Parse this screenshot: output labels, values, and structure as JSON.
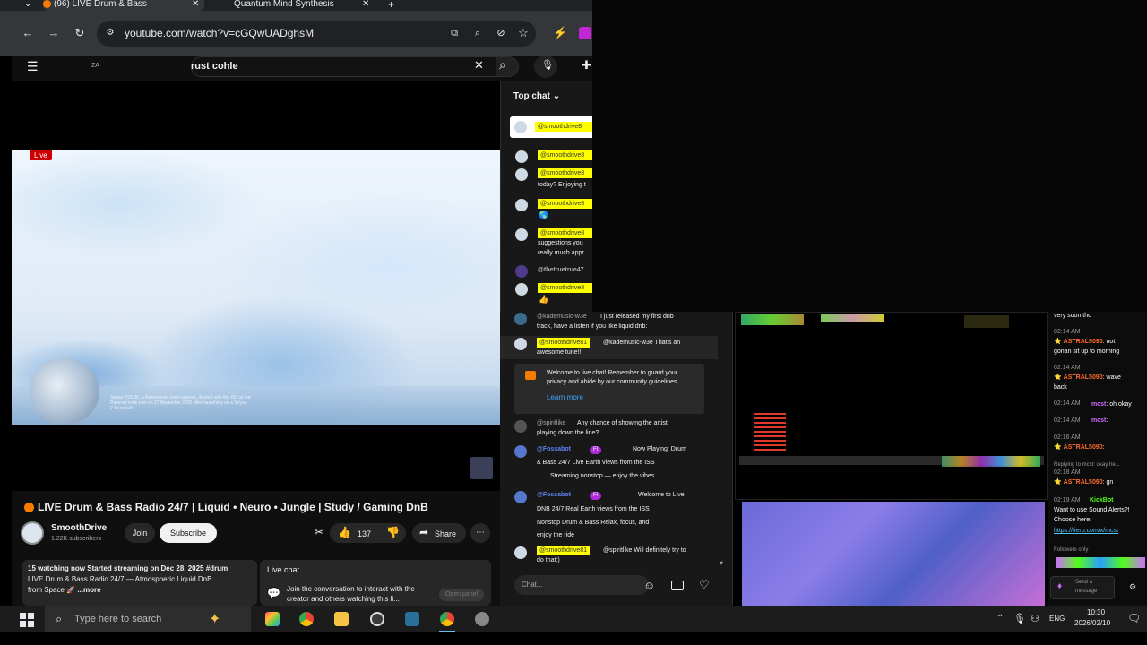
{
  "browser": {
    "tab1_title": "(96) LIVE Drum & Bass",
    "tab2_title": "Quantum Mind Synthesis",
    "url": "youtube.com/watch?v=cGQwUADghsM"
  },
  "youtube": {
    "country_code": "ZA",
    "search_value": "rust cohle",
    "live_badge": "Live",
    "video_caption": "Space: ISS 05, a Roscosmos crew capsule, docked with the ISS at the Rassvet node port on 27 November 2025 after launching on a Soyuz-2.1a rocket",
    "video_title": "LIVE Drum & Bass Radio 24/7 | Liquid • Neuro • Jungle | Study / Gaming DnB",
    "channel_name": "SmoothDrive",
    "subscribers": "1.22K subscribers",
    "join_label": "Join",
    "subscribe_label": "Subscribe",
    "like_count": "137",
    "share_label": "Share",
    "description_line1": "15 watching now  Started streaming on Dec 28, 2025  #drum",
    "description_line2": "LIVE Drum & Bass Radio 24/7 — Atmospheric Liquid DnB",
    "description_line3": "from Space",
    "description_more": "...more",
    "live_chat_title": "Live chat",
    "live_chat_text": "Join the conversation to interact with the creator and others watching this li...",
    "open_panel_label": "Open panel"
  },
  "chat": {
    "top_chat_label": "Top chat",
    "pinned_user": "@smoothdrive8",
    "messages_top": [
      {
        "user": "@smoothdrive8",
        "text": ""
      },
      {
        "user": "@smoothdrive8",
        "text": "today? Enjoying t"
      },
      {
        "user": "@smoothdrive8",
        "text": ""
      },
      {
        "user": "@smoothdrive8",
        "text": "suggestions you"
      },
      {
        "user": "",
        "text": "really much appr"
      },
      {
        "user": "@thetruetrue47",
        "text": ""
      },
      {
        "user": "@smoothdrive8",
        "text": ""
      }
    ],
    "msg_kade_user": "@kademusic-w3e",
    "msg_kade_text1": "I just released my first dnb",
    "msg_kade_text2": "track, have a listen if you like liquid dnb:",
    "msg_sd_reply_user": "@smoothdrive81",
    "msg_sd_reply_text1": "@kademusic-w3e That's an",
    "msg_sd_reply_text2": "awesome tune!!!",
    "welcome_text": "Welcome to live chat! Remember to guard your privacy and abide by our community guidelines.",
    "learn_more": "Learn more",
    "msg_spirit_user": "@spiritlike",
    "msg_spirit_text1": "Any chance of showing the artist",
    "msg_spirit_text2": "playing down the line?",
    "fossabot_user": "@Fossabot",
    "fossabot_badge": "FI",
    "fossabot1_line1": "Now Playing: Drum",
    "fossabot1_line2": "& Bass 24/7   Live Earth views from the ISS",
    "fossabot1_line3": "Streaming nonstop — enjoy the vibes",
    "fossabot2_line1": "Welcome to Live",
    "fossabot2_line2": "DNB 24/7 Real Earth views from the ISS",
    "fossabot2_line3": "Nonstop Drum & Bass   Relax, focus, and",
    "fossabot2_line4": "enjoy the ride",
    "msg_last_user": "@smoothdrive81",
    "msg_last_text1": "@spiritlike Will definitely try to",
    "msg_last_text2": "do that:)",
    "input_placeholder": "Chat..."
  },
  "kick": {
    "line0": "very soon tho",
    "t1": "02:14 AM",
    "u1": "ASTRAL5090",
    "m1a": ": not",
    "m1b": "gonan sit up to morning",
    "t2": "02:14 AM",
    "u2": "ASTRAL5090",
    "m2a": ": wave",
    "m2b": "back",
    "t3": "02:14 AM",
    "u3": "mcst",
    "m3": ": oh okay",
    "t4": "02:14 AM",
    "u4": "mcst",
    "m4": ":",
    "t5": "02:16 AM",
    "u5": "ASTRAL5090",
    "m5": ":",
    "reply": "Replying to mcst: okay he...",
    "t6": "02:18 AM",
    "u6": "ASTRAL5090",
    "m6": ": gn",
    "t7": "02:19 AM",
    "u7": "KickBot",
    "m7a": "Want to use Sound Alerts?!",
    "m7b": "Choose here:",
    "link": "https://tierp.com/x/mcst",
    "followers": "Followers only",
    "send": "Send a message"
  },
  "taskbar": {
    "search_placeholder": "Type here to search",
    "lang": "ENG",
    "time": "10:30",
    "date": "2026/02/10"
  },
  "colors": {
    "yt_bg": "#0f0f0f",
    "live_red": "#cc0000",
    "chat_highlight": "#fdff00",
    "kick_green": "#53fc18",
    "kick_orange": "#ff6b2b"
  }
}
